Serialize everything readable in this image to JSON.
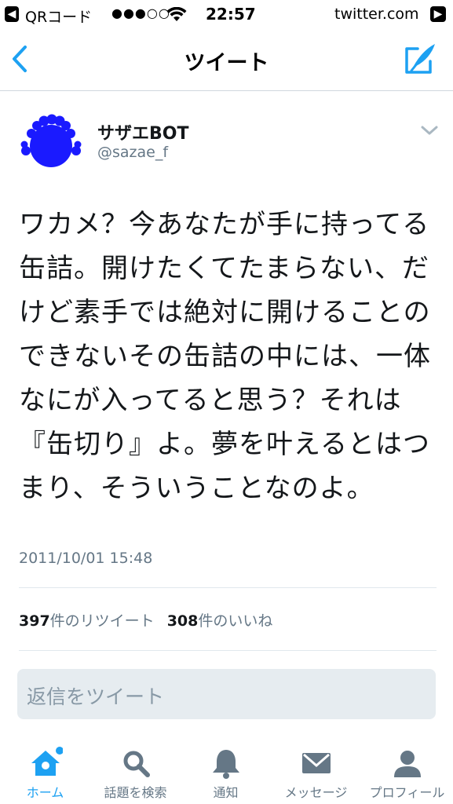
{
  "status_bar": {
    "back_app": "QRコード",
    "signal": "●●●○○",
    "time": "22:57",
    "site": "twitter.com"
  },
  "nav": {
    "title": "ツイート"
  },
  "tweet": {
    "author_name": "サザエBOT",
    "author_handle": "@sazae_f",
    "text": "ワカメ？今あなたが手に持ってる缶詰。開けたくてたまらない、だけど素手では絶対に開けることのできないその缶詰の中には、一体なにが入ってると思う？それは『缶切り』よ。夢を叶えるとはつまり、そういうことなのよ。",
    "timestamp": "2011/10/01 15:48"
  },
  "stats": {
    "retweets_count": "397",
    "retweets_label": "件のリツイート",
    "likes_count": "308",
    "likes_label": "件のいいね"
  },
  "reply": {
    "placeholder": "返信をツイート"
  },
  "tabs": [
    {
      "label": "ホーム",
      "icon": "home-icon",
      "active": true
    },
    {
      "label": "話題を検索",
      "icon": "search-icon",
      "active": false
    },
    {
      "label": "通知",
      "icon": "bell-icon",
      "active": false
    },
    {
      "label": "メッセージ",
      "icon": "envelope-icon",
      "active": false
    },
    {
      "label": "プロフィール",
      "icon": "person-icon",
      "active": false
    }
  ],
  "colors": {
    "accent": "#1da1f2",
    "avatar_blue": "#1a1aff",
    "muted": "#657786"
  }
}
